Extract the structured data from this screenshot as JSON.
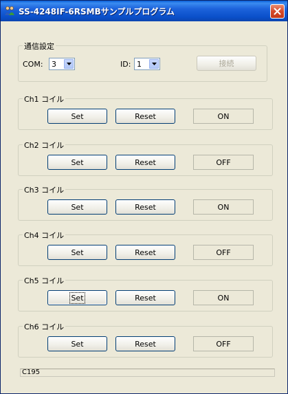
{
  "window": {
    "title": "SS-4248IF-6RSMBサンプルプログラム",
    "app_icon": "people-icon",
    "close_icon": "close-icon"
  },
  "comm": {
    "group_label": "通信設定",
    "com_label": "COM:",
    "com_value": "3",
    "id_label": "ID:",
    "id_value": "1",
    "connect_label": "接続"
  },
  "channels": [
    {
      "label": "Ch1 コイル",
      "set": "Set",
      "reset": "Reset",
      "state": "ON"
    },
    {
      "label": "Ch2 コイル",
      "set": "Set",
      "reset": "Reset",
      "state": "OFF"
    },
    {
      "label": "Ch3 コイル",
      "set": "Set",
      "reset": "Reset",
      "state": "ON"
    },
    {
      "label": "Ch4 コイル",
      "set": "Set",
      "reset": "Reset",
      "state": "OFF"
    },
    {
      "label": "Ch5 コイル",
      "set": "Set",
      "reset": "Reset",
      "state": "ON"
    },
    {
      "label": "Ch6 コイル",
      "set": "Set",
      "reset": "Reset",
      "state": "OFF"
    }
  ],
  "status": {
    "text": "C195"
  }
}
